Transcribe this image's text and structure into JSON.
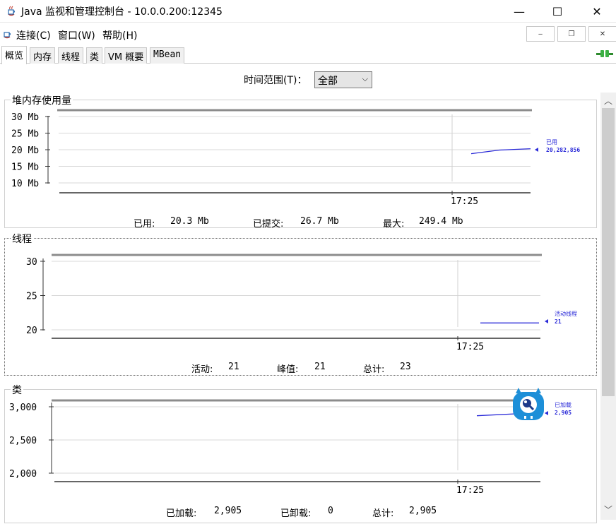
{
  "window": {
    "title": "Java 监视和管理控制台 - 10.0.0.200:12345"
  },
  "titlebar_buttons": {
    "minimize": "—",
    "maximize": "☐",
    "close": "✕"
  },
  "menu": {
    "items": [
      "连接(C)",
      "窗口(W)",
      "帮助(H)"
    ]
  },
  "mdi_buttons": {
    "minimize": "‒",
    "restore": "❐",
    "close": "✕"
  },
  "tabs": [
    "概览",
    "内存",
    "线程",
    "类",
    "VM 概要",
    "MBean"
  ],
  "time_range": {
    "label": "时间范围(T)：",
    "value": "全部",
    "arrow": "⌵"
  },
  "heap": {
    "title": "堆内存使用量",
    "y_ticks": [
      "30 Mb",
      "25 Mb",
      "20 Mb",
      "15 Mb",
      "10 Mb"
    ],
    "x_tick": "17:25",
    "legend_name": "已用",
    "legend_value": "20,282,856",
    "stats": {
      "used_label": "已用:",
      "used_value": "20.3 Mb",
      "committed_label": "已提交:",
      "committed_value": "26.7 Mb",
      "max_label": "最大:",
      "max_value": "249.4 Mb"
    }
  },
  "threads": {
    "title": "线程",
    "y_ticks": [
      "30",
      "25",
      "20"
    ],
    "x_tick": "17:25",
    "legend_name": "活动线程",
    "legend_value": "21",
    "stats": {
      "live_label": "活动:",
      "live_value": "21",
      "peak_label": "峰值:",
      "peak_value": "21",
      "total_label": "总计:",
      "total_value": "23"
    }
  },
  "classes": {
    "title": "类",
    "y_ticks": [
      "3,000",
      "2,500",
      "2,000"
    ],
    "x_tick": "17:25",
    "legend_name": "已加载",
    "legend_value": "2,905",
    "stats": {
      "loaded_label": "已加载:",
      "loaded_value": "2,905",
      "unloaded_label": "已卸载:",
      "unloaded_value": "0",
      "total_label": "总计:",
      "total_value": "2,905"
    }
  },
  "chart_data": [
    {
      "type": "line",
      "title": "堆内存使用量",
      "ylim": [
        10,
        30
      ],
      "series": [
        {
          "name": "已用",
          "x": [
            "17:25",
            "17:25",
            "17:25"
          ],
          "y": [
            18.8,
            19.9,
            20.3
          ]
        }
      ]
    },
    {
      "type": "line",
      "title": "线程",
      "ylim": [
        20,
        30
      ],
      "series": [
        {
          "name": "活动线程",
          "x": [
            "17:25",
            "17:25"
          ],
          "y": [
            21,
            21
          ]
        }
      ]
    },
    {
      "type": "line",
      "title": "类",
      "ylim": [
        2000,
        3000
      ],
      "series": [
        {
          "name": "已加载",
          "x": [
            "17:25",
            "17:25"
          ],
          "y": [
            2865,
            2905
          ]
        }
      ]
    }
  ],
  "colors": {
    "series": "#2b2bd8",
    "grid": "#d8d8d8",
    "frame": "#8c8c8c"
  }
}
